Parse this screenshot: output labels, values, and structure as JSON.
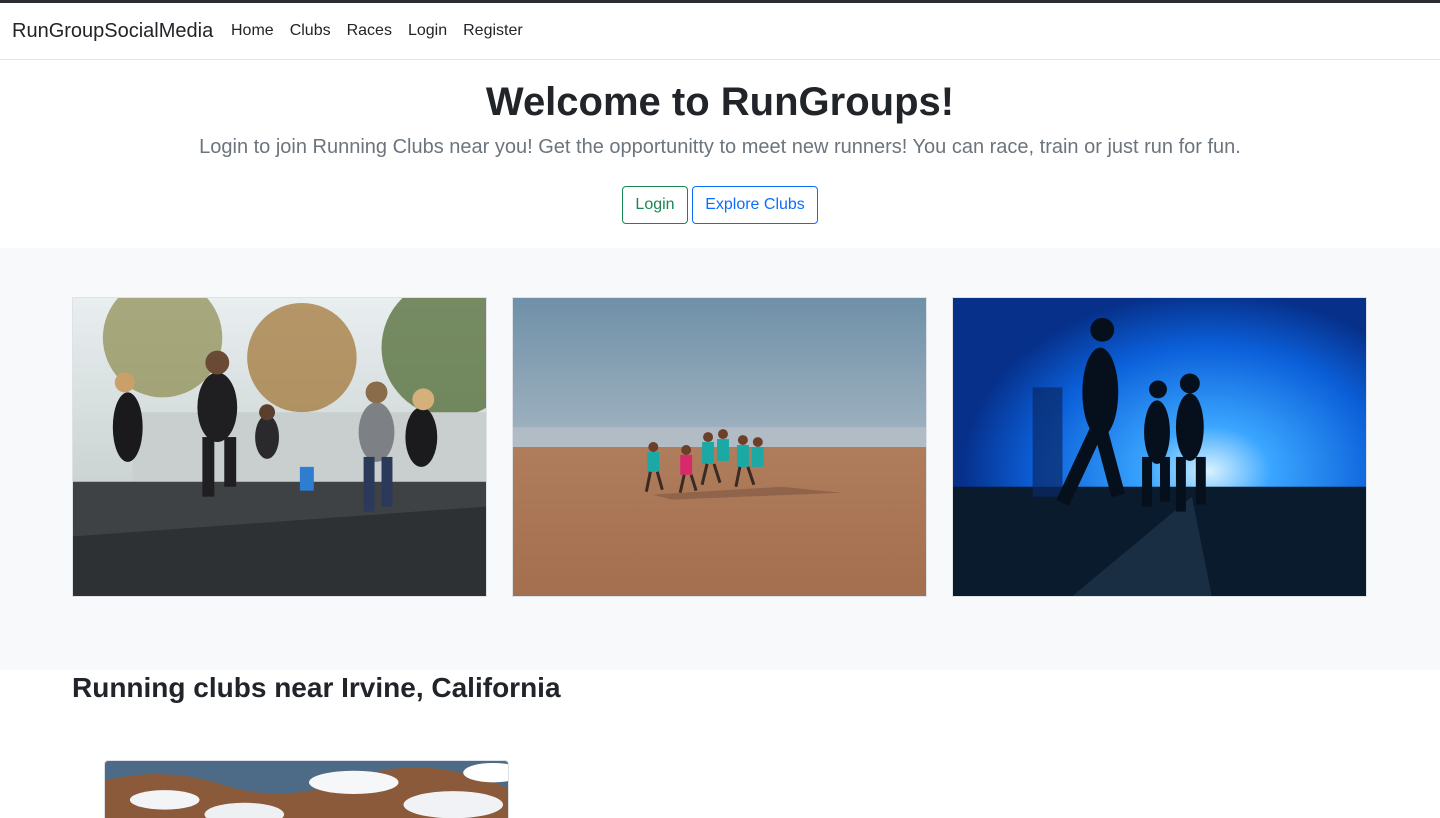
{
  "navbar": {
    "brand": "RunGroupSocialMedia",
    "links": [
      {
        "label": "Home"
      },
      {
        "label": "Clubs"
      },
      {
        "label": "Races"
      },
      {
        "label": "Login"
      },
      {
        "label": "Register"
      }
    ]
  },
  "hero": {
    "title": "Welcome to RunGroups!",
    "subtitle": "Login to join Running Clubs near you! Get the opportunitty to meet new runners! You can race, train or just run for fun.",
    "login_button": "Login",
    "explore_button": "Explore Clubs"
  },
  "gallery": {
    "images": [
      {
        "icon": "group-running-photo"
      },
      {
        "icon": "beach-running-photo"
      },
      {
        "icon": "night-running-photo"
      }
    ]
  },
  "clubs": {
    "heading": "Running clubs near Irvine, California",
    "cards": [
      {
        "icon": "mountain-landscape-photo"
      }
    ]
  },
  "colors": {
    "login_button": "#198754",
    "explore_button": "#0d6efd",
    "gallery_background": "#f8f9fa"
  }
}
